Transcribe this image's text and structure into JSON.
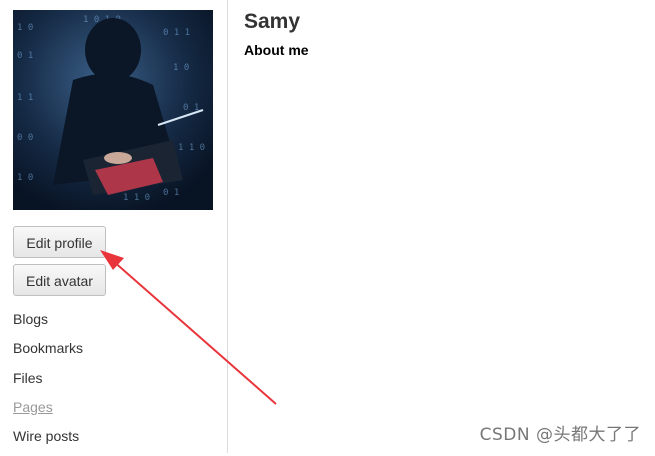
{
  "profile": {
    "name": "Samy",
    "about_heading": "About me"
  },
  "actions": {
    "edit_profile": "Edit profile",
    "edit_avatar": "Edit avatar"
  },
  "menu": [
    {
      "label": "Blogs",
      "state": "normal"
    },
    {
      "label": "Bookmarks",
      "state": "normal"
    },
    {
      "label": "Files",
      "state": "normal"
    },
    {
      "label": "Pages",
      "state": "muted"
    },
    {
      "label": "Wire posts",
      "state": "normal"
    }
  ],
  "annotation": {
    "arrow_color": "#e8343a"
  },
  "watermark": "CSDN @头都大了了"
}
